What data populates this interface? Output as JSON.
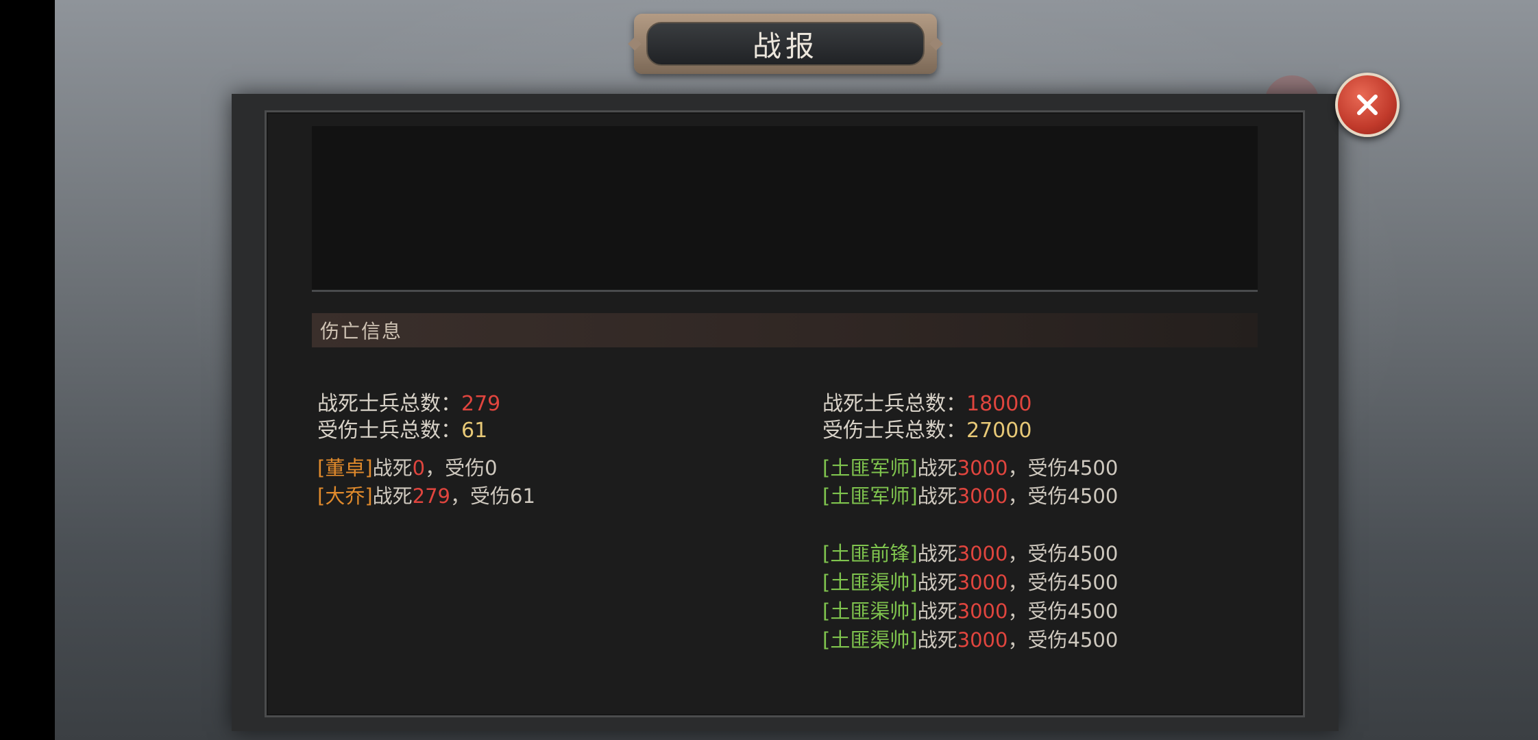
{
  "title": "战报",
  "section_title": "伤亡信息",
  "left": {
    "killed_label": "战死士兵总数：",
    "killed_value": "279",
    "wounded_label": "受伤士兵总数：",
    "wounded_value": "61",
    "generals": [
      {
        "name": "[董卓]",
        "killed_label": "战死",
        "killed": "0",
        "wounded_label": "，受伤",
        "wounded": "0"
      },
      {
        "name": "[大乔]",
        "killed_label": "战死",
        "killed": "279",
        "wounded_label": "，受伤",
        "wounded": "61"
      }
    ]
  },
  "right": {
    "killed_label": "战死士兵总数：",
    "killed_value": "18000",
    "wounded_label": "受伤士兵总数：",
    "wounded_value": "27000",
    "enemies": [
      {
        "name": "[土匪军师]",
        "killed_label": "战死",
        "killed": "3000",
        "wounded_label": "，受伤",
        "wounded": "4500"
      },
      {
        "name": "[土匪军师]",
        "killed_label": "战死",
        "killed": "3000",
        "wounded_label": "，受伤",
        "wounded": "4500"
      },
      {
        "name": "[土匪前锋]",
        "killed_label": "战死",
        "killed": "3000",
        "wounded_label": "，受伤",
        "wounded": "4500"
      },
      {
        "name": "[土匪渠帅]",
        "killed_label": "战死",
        "killed": "3000",
        "wounded_label": "，受伤",
        "wounded": "4500"
      },
      {
        "name": "[土匪渠帅]",
        "killed_label": "战死",
        "killed": "3000",
        "wounded_label": "，受伤",
        "wounded": "4500"
      },
      {
        "name": "[土匪渠帅]",
        "killed_label": "战死",
        "killed": "3000",
        "wounded_label": "，受伤",
        "wounded": "4500"
      }
    ]
  },
  "icons": {
    "close": "close-icon"
  },
  "colors": {
    "killed": "#e0453e",
    "wounded": "#e8c977",
    "ally_name": "#e08a2c",
    "enemy_name": "#7fc44e"
  }
}
